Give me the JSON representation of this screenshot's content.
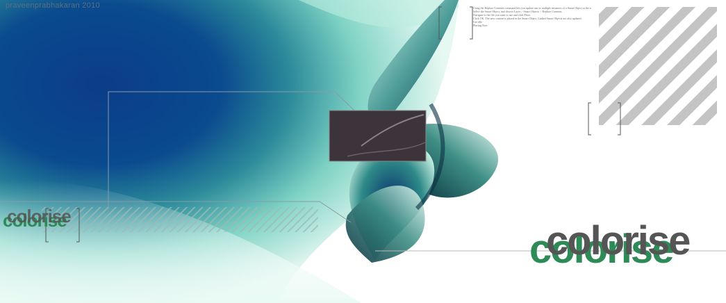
{
  "credit": "praveenprabhakaran 2010",
  "instructions": [
    "Using the Replace Contents command lets you update one or multiple instances of a Smart Object at the same time.",
    "Select the Smart Object, and choose Layer > Smart Objects > Replace Contents.",
    "Navigate to the file you want to use and click Place.",
    "Click OK. The new content is placed in the Smart Object. Linked Smart Objects are also updated.",
    "Get idle",
    "Placing Now"
  ],
  "logo": {
    "text": "colorise",
    "primary_color": "#555555",
    "accent_color": "#2e8b57"
  },
  "colors": {
    "deep_blue": "#0a3f8c",
    "teal": "#1f6e74",
    "mint": "#bfece0",
    "stripe": "#c4c4c4"
  }
}
